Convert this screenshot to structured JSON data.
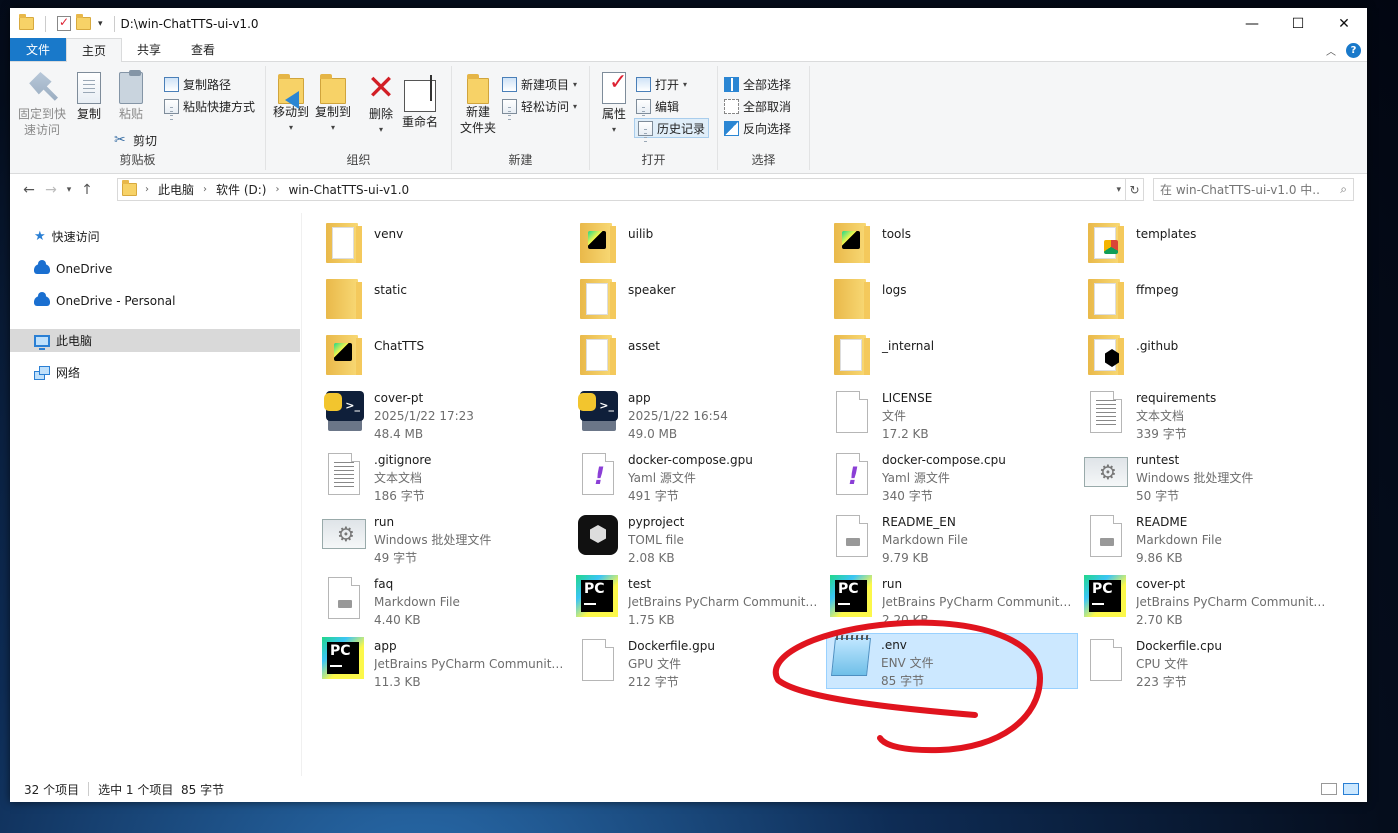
{
  "window": {
    "title": "D:\\win-ChatTTS-ui-v1.0",
    "minimize": "—",
    "maximize": "☐",
    "close": "✕"
  },
  "ribbon_tabs": [
    "文件",
    "主页",
    "共享",
    "查看"
  ],
  "ribbon": {
    "clipboard": {
      "label": "剪贴板",
      "pin": "固定到快\n速访问",
      "copy": "复制",
      "paste": "粘贴",
      "copy_path": "复制路径",
      "paste_shortcut": "粘贴快捷方式",
      "cut": "剪切"
    },
    "organize": {
      "label": "组织",
      "move_to": "移动到",
      "copy_to": "复制到",
      "delete": "删除",
      "rename": "重命名"
    },
    "new": {
      "label": "新建",
      "new_folder": "新建\n文件夹",
      "new_item": "新建项目",
      "easy_access": "轻松访问"
    },
    "open": {
      "label": "打开",
      "properties": "属性",
      "open": "打开",
      "edit": "编辑",
      "history": "历史记录"
    },
    "select": {
      "label": "选择",
      "select_all": "全部选择",
      "select_none": "全部取消",
      "invert": "反向选择"
    }
  },
  "address": {
    "crumbs": [
      "此电脑",
      "软件 (D:)",
      "win-ChatTTS-ui-v1.0"
    ],
    "search_placeholder": "在 win-ChatTTS-ui-v1.0 中..."
  },
  "sidebar": [
    {
      "label": "快速访问",
      "icon": "star-icon"
    },
    {
      "label": "OneDrive",
      "icon": "cloud-icon"
    },
    {
      "label": "OneDrive - Personal",
      "icon": "cloud-icon"
    },
    {
      "label": "此电脑",
      "icon": "computer-icon",
      "selected": true
    },
    {
      "label": "网络",
      "icon": "network-icon"
    }
  ],
  "files": [
    {
      "name": "venv",
      "type": "folder",
      "badge": "img"
    },
    {
      "name": "uilib",
      "type": "folder",
      "badge": "pc"
    },
    {
      "name": "tools",
      "type": "folder",
      "badge": "pc"
    },
    {
      "name": "templates",
      "type": "folder",
      "badge": "chrome"
    },
    {
      "name": "static",
      "type": "folder",
      "badge": "none"
    },
    {
      "name": "speaker",
      "type": "folder",
      "badge": "page"
    },
    {
      "name": "logs",
      "type": "folder",
      "badge": "none"
    },
    {
      "name": "ffmpeg",
      "type": "folder",
      "badge": "blue"
    },
    {
      "name": "ChatTTS",
      "type": "folder",
      "badge": "pc"
    },
    {
      "name": "asset",
      "type": "folder",
      "badge": "page"
    },
    {
      "name": "_internal",
      "type": "folder",
      "badge": "gear"
    },
    {
      "name": ".github",
      "type": "folder",
      "badge": "gh"
    },
    {
      "name": "cover-pt",
      "type": "pyexe",
      "sub1": "2025/1/22 17:23",
      "sub2": "48.4 MB"
    },
    {
      "name": "app",
      "type": "pyexe",
      "sub1": "2025/1/22 16:54",
      "sub2": "49.0 MB"
    },
    {
      "name": "LICENSE",
      "type": "plain",
      "sub1": "文件",
      "sub2": "17.2 KB"
    },
    {
      "name": "requirements",
      "type": "text",
      "sub1": "文本文档",
      "sub2": "339 字节"
    },
    {
      "name": ".gitignore",
      "type": "text",
      "sub1": "文本文档",
      "sub2": "186 字节"
    },
    {
      "name": "docker-compose.gpu",
      "type": "yaml",
      "sub1": "Yaml 源文件",
      "sub2": "491 字节"
    },
    {
      "name": "docker-compose.cpu",
      "type": "yaml",
      "sub1": "Yaml 源文件",
      "sub2": "340 字节"
    },
    {
      "name": "runtest",
      "type": "bat",
      "sub1": "Windows 批处理文件",
      "sub2": "50 字节"
    },
    {
      "name": "run",
      "type": "bat",
      "sub1": "Windows 批处理文件",
      "sub2": "49 字节"
    },
    {
      "name": "pyproject",
      "type": "toml",
      "sub1": "TOML file",
      "sub2": "2.08 KB"
    },
    {
      "name": "README_EN",
      "type": "md",
      "sub1": "Markdown File",
      "sub2": "9.79 KB"
    },
    {
      "name": "README",
      "type": "md",
      "sub1": "Markdown File",
      "sub2": "9.86 KB"
    },
    {
      "name": "faq",
      "type": "md",
      "sub1": "Markdown File",
      "sub2": "4.40 KB"
    },
    {
      "name": "test",
      "type": "pycharm",
      "sub1": "JetBrains PyCharm Community...",
      "sub2": "1.75 KB"
    },
    {
      "name": "run",
      "type": "pycharm",
      "sub1": "JetBrains PyCharm Community...",
      "sub2": "2.20 KB"
    },
    {
      "name": "cover-pt",
      "type": "pycharm",
      "sub1": "JetBrains PyCharm Community...",
      "sub2": "2.70 KB"
    },
    {
      "name": "app",
      "type": "pycharm",
      "sub1": "JetBrains PyCharm Community...",
      "sub2": "11.3 KB"
    },
    {
      "name": "Dockerfile.gpu",
      "type": "plain",
      "sub1": "GPU 文件",
      "sub2": "212 字节"
    },
    {
      "name": ".env",
      "type": "notepad",
      "sub1": "ENV 文件",
      "sub2": "85 字节",
      "selected": true
    },
    {
      "name": "Dockerfile.cpu",
      "type": "plain",
      "sub1": "CPU 文件",
      "sub2": "223 字节"
    }
  ],
  "status": {
    "count": "32 个项目",
    "selected": "选中 1 个项目  85 字节"
  },
  "annotation_color": "#e0141e"
}
